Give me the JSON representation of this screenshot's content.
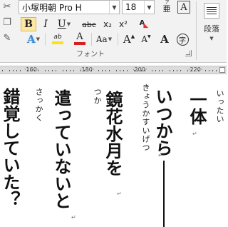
{
  "ribbon": {
    "font_name": "小塚明朝 Pro H",
    "font_size": "18",
    "buttons": {
      "bold": "B",
      "italic": "I",
      "underline": "U",
      "strikethrough": "abc",
      "subscript": "x₂",
      "superscript": "x²",
      "text_effects": "A",
      "highlight": "ab",
      "font_color": "A",
      "change_case": "Aa",
      "grow_font": "A",
      "shrink_font": "A",
      "enclose": "字",
      "phonetic_guide": "亜",
      "clear_format": "A",
      "char_border": "A",
      "ruby_glyph": "A"
    },
    "font_group_label": "フォント",
    "paragraph_label": "段落",
    "colors": {
      "highlight": "#f7e31a",
      "font_color": "#d42020",
      "effects": "#3a8ad6",
      "selected": "#fce8a4"
    }
  },
  "ruler": {
    "labels": [
      "160",
      "180",
      "200",
      "220"
    ]
  },
  "document": {
    "columns": [
      {
        "text": "一体",
        "ruby": "いったい"
      },
      {
        "text": "いつから――",
        "ruby": ""
      },
      {
        "text": "鏡花水月を",
        "ruby": "きょうかすいげつ"
      },
      {
        "text": "遣っていないと",
        "ruby": "つか"
      },
      {
        "text": "錯覚していた？",
        "ruby": "さっかく"
      }
    ],
    "para_mark": "↵"
  }
}
